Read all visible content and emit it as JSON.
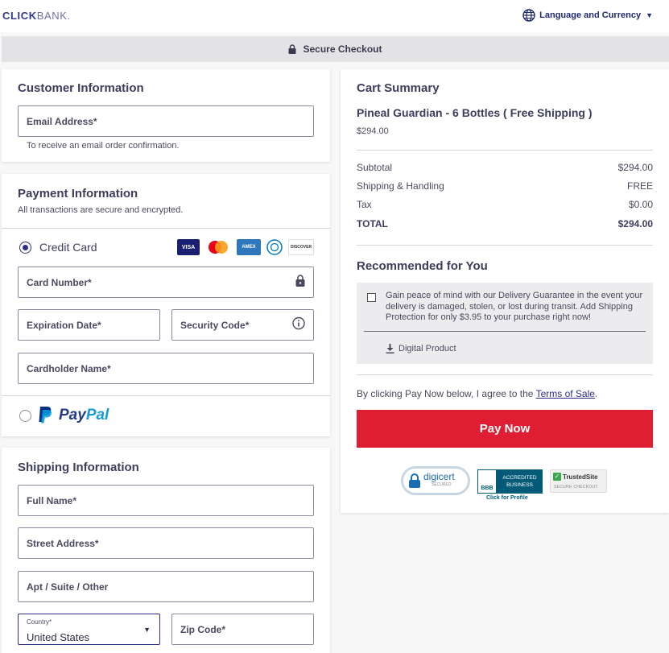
{
  "header": {
    "logo_bold": "CLICK",
    "logo_light": "BANK.",
    "language_label": "Language and Currency"
  },
  "secure_bar": {
    "label": "Secure Checkout"
  },
  "customer": {
    "title": "Customer Information",
    "email_label": "Email Address*",
    "email_hint": "To receive an email order confirmation."
  },
  "payment": {
    "title": "Payment Information",
    "subtitle": "All transactions are secure and encrypted.",
    "credit_card_label": "Credit Card",
    "card_badges": [
      "VISA",
      "AMEX",
      "DISCOVER"
    ],
    "card_number_label": "Card Number*",
    "expiration_label": "Expiration Date*",
    "security_code_label": "Security Code*",
    "cardholder_label": "Cardholder Name*",
    "paypal_pay": "Pay",
    "paypal_pal": "Pal"
  },
  "shipping": {
    "title": "Shipping Information",
    "full_name_label": "Full Name*",
    "street_label": "Street Address*",
    "apt_label": "Apt / Suite / Other",
    "country_label": "Country*",
    "country_value": "United States",
    "zip_label": "Zip Code*"
  },
  "cart": {
    "title": "Cart Summary",
    "product_name": "Pineal Guardian - 6 Bottles ( Free Shipping )",
    "product_price": "$294.00",
    "rows": [
      {
        "label": "Subtotal",
        "value": "$294.00"
      },
      {
        "label": "Shipping & Handling",
        "value": "FREE"
      },
      {
        "label": "Tax",
        "value": "$0.00"
      }
    ],
    "total_label": "TOTAL",
    "total_value": "$294.00"
  },
  "recommended": {
    "title": "Recommended for You",
    "offer_text": "Gain peace of mind with our Delivery Guarantee in the event your delivery is damaged, stolen, or lost during transit. Add Shipping Protection for only $3.95 to your purchase right now!",
    "digital_label": "Digital Product"
  },
  "terms": {
    "prefix": "By clicking Pay Now below, I agree to the ",
    "link": "Terms of Sale",
    "suffix": "."
  },
  "pay_button": {
    "label": "Pay Now"
  },
  "trust": {
    "digicert": "digicert",
    "digicert_sub": "SECURED",
    "bbb_line1": "ACCREDITED",
    "bbb_line2": "BUSINESS",
    "bbb_logo": "BBB",
    "bbb_click": "Click for Profile",
    "trustedsite": "TrustedSite",
    "trustedsite_sub": "SECURE CHECKOUT"
  },
  "colors": {
    "accent": "#2b2e8c",
    "pay_button": "#e01e33",
    "link": "#2b2e8c"
  }
}
